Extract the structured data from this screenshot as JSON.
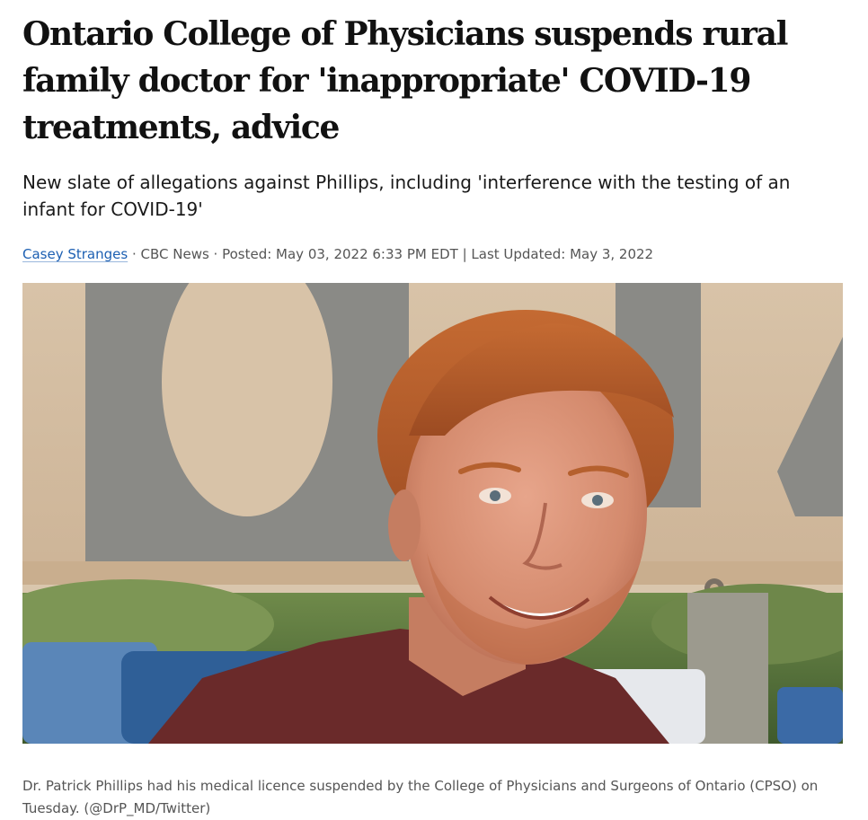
{
  "article": {
    "headline": "Ontario College of Physicians suspends rural family doctor for 'inappropriate' COVID-19 treatments, advice",
    "deck": "New slate of allegations against Phillips, including 'interference with the testing of an infant for COVID-19'",
    "byline": {
      "author": "Casey Stranges",
      "separator_1": " · ",
      "outlet": "CBC News",
      "separator_2": " · ",
      "posted": "Posted: May 03, 2022 6:33 PM EDT",
      "separator_3": " | ",
      "updated": "Last Updated: May 3, 2022"
    },
    "photo": {
      "alt_subject": "Dr. Patrick Phillips"
    },
    "caption": "Dr. Patrick Phillips had his medical licence suspended by the College of Physicians and Surgeons of Ontario (CPSO) on Tuesday. (@DrP_MD/Twitter)"
  },
  "colors": {
    "link": "#1c5fb2",
    "meta_text": "#555555",
    "headline": "#111111"
  }
}
